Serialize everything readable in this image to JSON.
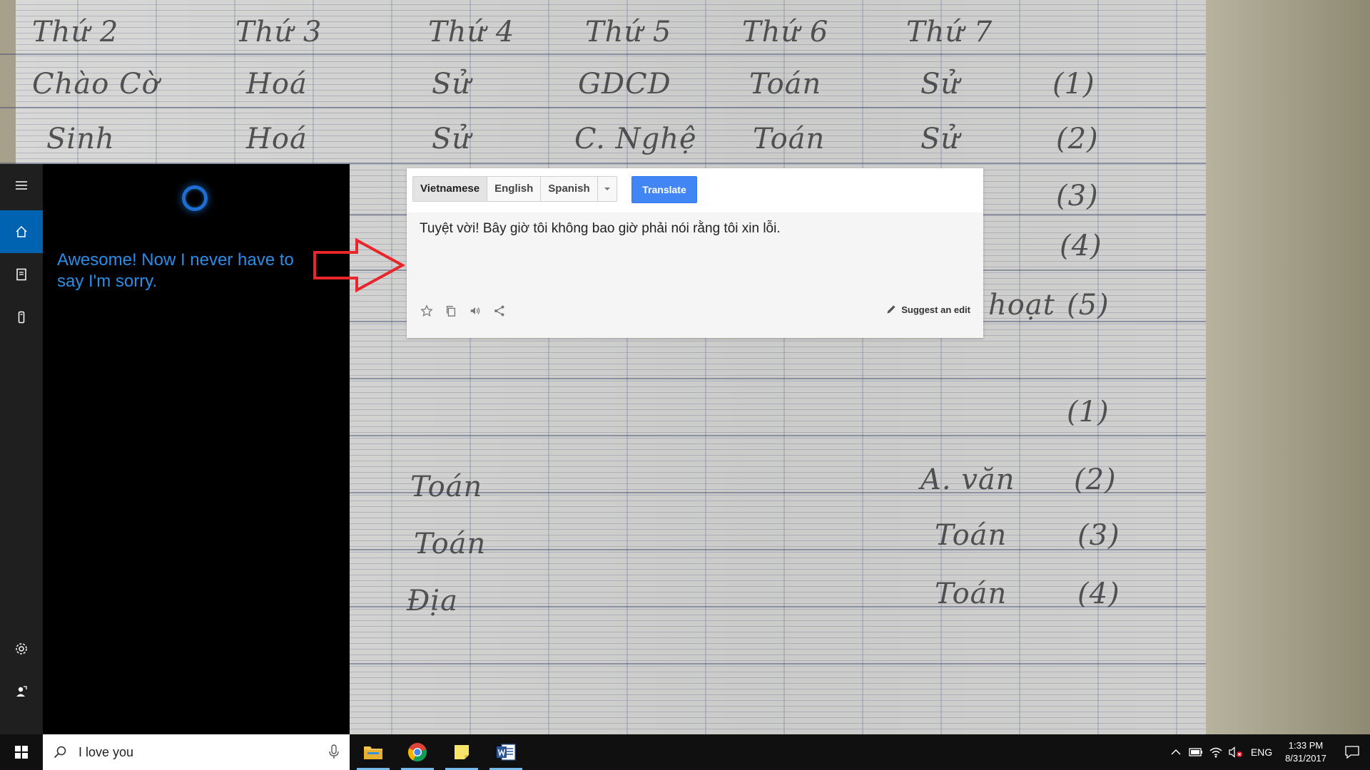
{
  "background": {
    "handwriting": [
      {
        "text": "Thứ 2"
      },
      {
        "text": "Thứ 3"
      },
      {
        "text": "Thứ 4"
      },
      {
        "text": "Thứ 5"
      },
      {
        "text": "Thứ 6"
      },
      {
        "text": "Thứ 7"
      },
      {
        "text": "Chào Cờ"
      },
      {
        "text": "Hoá"
      },
      {
        "text": "Sử"
      },
      {
        "text": "GDCD"
      },
      {
        "text": "Toán"
      },
      {
        "text": "Sử"
      },
      {
        "text": "(1)"
      },
      {
        "text": "Sinh"
      },
      {
        "text": "Hoá"
      },
      {
        "text": "Sử"
      },
      {
        "text": "C. Nghệ"
      },
      {
        "text": "Toán"
      },
      {
        "text": "Sử"
      },
      {
        "text": "(2)"
      },
      {
        "text": "(3)"
      },
      {
        "text": "(4)"
      },
      {
        "text": "hoạt"
      },
      {
        "text": "(5)"
      },
      {
        "text": "(1)"
      },
      {
        "text": "Toán"
      },
      {
        "text": "A. văn"
      },
      {
        "text": "(2)"
      },
      {
        "text": "Toán"
      },
      {
        "text": "Toán"
      },
      {
        "text": "(3)"
      },
      {
        "text": "Địa"
      },
      {
        "text": "Toán"
      },
      {
        "text": "(4)"
      }
    ]
  },
  "cortana": {
    "reply": "Awesome! Now I never have to say I'm sorry.",
    "rail_icons": [
      "hamburger-icon",
      "home-icon",
      "notebook-icon",
      "devices-icon",
      "settings-icon",
      "feedback-icon"
    ]
  },
  "translate": {
    "languages": [
      "Vietnamese",
      "English",
      "Spanish"
    ],
    "selected_language": "Vietnamese",
    "translate_label": "Translate",
    "result": "Tuyệt vời! Bây giờ tôi không bao giờ phải nói rằng tôi xin lỗi.",
    "suggest_label": "Suggest an edit",
    "accent": "#4285f4"
  },
  "taskbar": {
    "search_value": "I love you",
    "apps": [
      "file-explorer",
      "chrome",
      "sticky-notes",
      "word"
    ],
    "language": "ENG",
    "time": "1:33 PM",
    "date": "8/31/2017"
  },
  "colors": {
    "cortana_blue": "#2a8ee8",
    "rail_active": "#0063b1",
    "arrow_red": "#e8262b"
  }
}
